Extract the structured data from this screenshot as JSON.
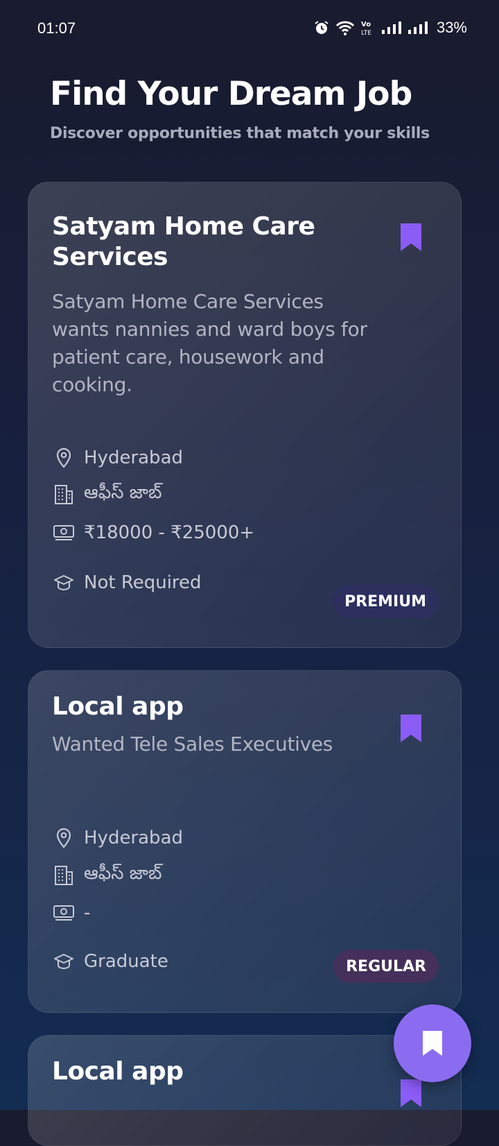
{
  "status_bar": {
    "time": "01:07",
    "battery": "33%",
    "icons": [
      "alarm-icon",
      "wifi-icon",
      "volte-icon",
      "signal-icon",
      "signal-icon"
    ]
  },
  "header": {
    "title": "Find Your Dream Job",
    "subtitle": "Discover opportunities that match your skills"
  },
  "jobs": [
    {
      "title": "Satyam Home Care Services",
      "description": "Satyam Home Care Services wants nannies and ward boys for patient care, housework and cooking.",
      "location": "Hyderabad",
      "job_type": "ఆఫీస్ జాబ్",
      "salary": "₹18000 - ₹25000+",
      "education": "Not Required",
      "tag": "PREMIUM"
    },
    {
      "title": "Local app",
      "description": "Wanted Tele Sales Executives",
      "location": "Hyderabad",
      "job_type": "ఆఫీస్ జాబ్",
      "salary": "-",
      "education": "Graduate",
      "tag": "REGULAR"
    },
    {
      "title": "Local app"
    }
  ],
  "colors": {
    "accent": "#8b6cf0",
    "bookmark": "#8b5cf6",
    "premium_badge": "#2d2f5e",
    "regular_badge": "#44305a"
  },
  "fab": {
    "icon": "bookmark-icon"
  }
}
